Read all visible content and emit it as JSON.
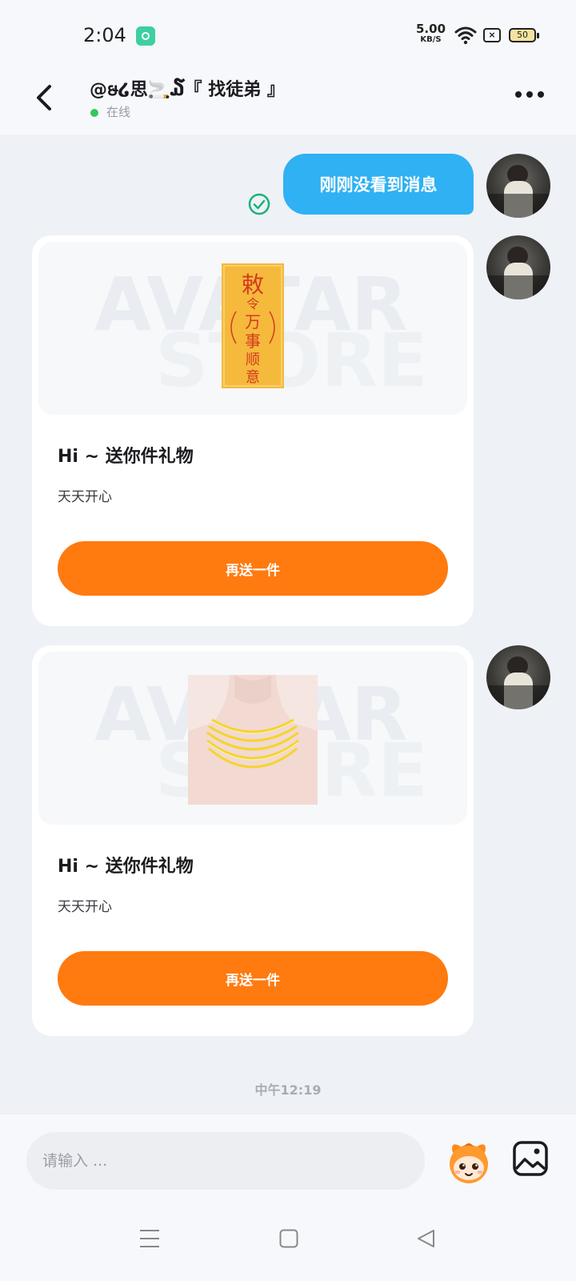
{
  "status_bar": {
    "time": "2:04",
    "net_speed_value": "5.00",
    "net_speed_unit": "KB/S",
    "battery": "50"
  },
  "header": {
    "title": "@ໟ໒思🚬ฺ໓『 找徒弟 』",
    "status": "在线"
  },
  "messages": {
    "sent_text": "刚刚没看到消息",
    "gifts": [
      {
        "title": "Hi ~ 送你件礼物",
        "subtitle": "天天开心",
        "button": "再送一件",
        "image": "amulet-paper",
        "image_text": [
          "敕",
          "令",
          "万",
          "事",
          "顺",
          "意"
        ]
      },
      {
        "title": "Hi ~ 送你件礼物",
        "subtitle": "天天开心",
        "button": "再送一件",
        "image": "gold-necklace"
      }
    ],
    "watermark": [
      "AVATAR",
      "STORE"
    ],
    "timestamp": "中午12:19"
  },
  "composer": {
    "placeholder": "请输入 ..."
  },
  "colors": {
    "accent_blue": "#2fb1f3",
    "accent_orange": "#ff7a0f",
    "online_green": "#34c759",
    "check_green": "#1ab27a",
    "background": "#eef1f6"
  },
  "icons": [
    "back-arrow-icon",
    "more-dots-icon",
    "check-circle-icon",
    "emoji-mascot-icon",
    "image-icon",
    "nav-menu-icon",
    "nav-home-icon",
    "nav-back-icon",
    "wifi-icon"
  ]
}
